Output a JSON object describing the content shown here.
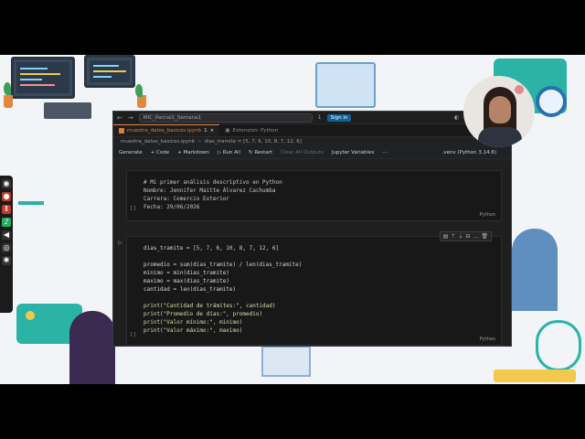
{
  "colors": {
    "accent": "#e27c3a",
    "signin": "#0e639c",
    "background": "#1f1f1f"
  },
  "titlebar": {
    "nav_back": "←",
    "nav_forward": "→",
    "command_center": "MIC_Parcial1_Semana1",
    "notifications": "1",
    "signin_label": "Sign in"
  },
  "tabs": [
    {
      "label": "muestra_datos_basicos.ipynb",
      "badge": "1",
      "close": "×"
    },
    {
      "label": "Extension: Python"
    }
  ],
  "breadcrumb": {
    "file": "muestra_datos_basicos.ipynb",
    "sep": ">",
    "symbol": "dias_tramite = [5, 7, 6, 10, 8, 7, 12, 6]"
  },
  "toolbar": {
    "generate": "Generate",
    "code": "+ Code",
    "markdown": "+ Markdown",
    "run_all": "▷ Run All",
    "restart": "↻ Restart",
    "clear_all": "Clear All Outputs",
    "variables": "Jupyter Variables",
    "more": "···",
    "kernel": ".venv (Python 3.14.6)"
  },
  "markdown_cell": {
    "lines": [
      "# Mi primer análisis descriptivo en Python",
      "Nombre: Jennifer Maitte Álvarez Cachumba",
      "Carrera: Comercio Exterior",
      "Fecha: 29/06/2026"
    ],
    "lang": "Python",
    "bracket": "[ ]"
  },
  "code_cell": {
    "lines": [
      "dias_tramite = [5, 7, 6, 10, 8, 7, 12, 6]",
      "",
      "promedio = sum(dias_tramite) / len(dias_tramite)",
      "minimo = min(dias_tramite)",
      "maximo = max(dias_tramite)",
      "cantidad = len(dias_tramite)",
      "",
      "print(\"Cantidad de trámites:\", cantidad)",
      "print(\"Promedio de días:\", promedio)",
      "print(\"Valor mínimo:\", minimo)",
      "print(\"Valor máximo:\", maximo)"
    ],
    "lang": "Python",
    "bracket": "[ ]",
    "run_icon": "▷"
  }
}
